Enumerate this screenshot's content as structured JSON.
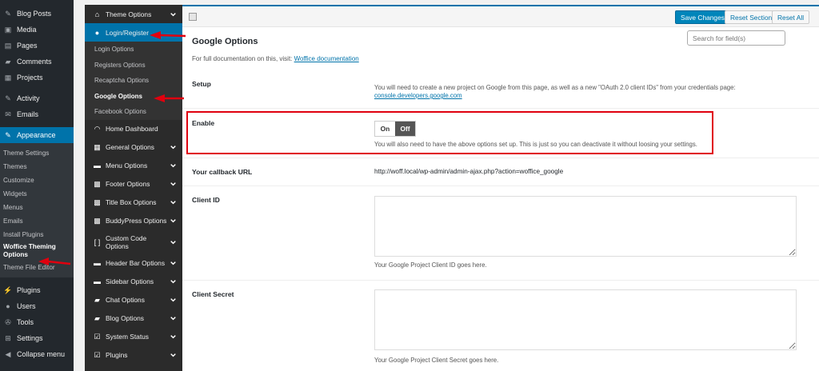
{
  "wp_menu": {
    "items_top": [
      {
        "label": "Blog Posts",
        "icon": "pin-icon",
        "glyph": "✎"
      },
      {
        "label": "Media",
        "icon": "media-icon",
        "glyph": "▣"
      },
      {
        "label": "Pages",
        "icon": "pages-icon",
        "glyph": "▤"
      },
      {
        "label": "Comments",
        "icon": "comment-icon",
        "glyph": "▰"
      },
      {
        "label": "Projects",
        "icon": "projects-icon",
        "glyph": "▦"
      }
    ],
    "items_mid": [
      {
        "label": "Activity",
        "icon": "activity-icon",
        "glyph": "✎"
      },
      {
        "label": "Emails",
        "icon": "email-icon",
        "glyph": "✉"
      }
    ],
    "appearance": {
      "label": "Appearance",
      "glyph": "✎"
    },
    "appearance_sub": [
      "Theme Settings",
      "Themes",
      "Customize",
      "Widgets",
      "Menus",
      "Emails",
      "Install Plugins",
      "Woffice Theming Options",
      "Theme File Editor"
    ],
    "items_bottom": [
      {
        "label": "Plugins",
        "icon": "plugins-icon",
        "glyph": "⚡"
      },
      {
        "label": "Users",
        "icon": "users-icon",
        "glyph": "●"
      },
      {
        "label": "Tools",
        "icon": "tools-icon",
        "glyph": "✇"
      },
      {
        "label": "Settings",
        "icon": "settings-icon",
        "glyph": "⊞"
      },
      {
        "label": "Collapse menu",
        "icon": "collapse-icon",
        "glyph": "◀"
      }
    ]
  },
  "theme_menu": {
    "theme_options": "Theme Options",
    "login_register": "Login/Register",
    "login_sub": [
      "Login Options",
      "Registers Options",
      "Recaptcha Options",
      "Google Options",
      "Facebook Options"
    ],
    "items": [
      {
        "label": "Home Dashboard",
        "icon": "dashboard-icon",
        "glyph": "◠"
      },
      {
        "label": "General Options",
        "icon": "grid-icon",
        "glyph": "▦"
      },
      {
        "label": "Menu Options",
        "icon": "menu-icon",
        "glyph": "▬"
      },
      {
        "label": "Footer Options",
        "icon": "footer-icon",
        "glyph": "▩"
      },
      {
        "label": "Title Box Options",
        "icon": "title-box-icon",
        "glyph": "▩"
      },
      {
        "label": "BuddyPress Options",
        "icon": "buddypress-icon",
        "glyph": "▩"
      },
      {
        "label": "Custom Code Options",
        "icon": "code-icon",
        "glyph": "[ ]"
      },
      {
        "label": "Header Bar Options",
        "icon": "header-icon",
        "glyph": "▬"
      },
      {
        "label": "Sidebar Options",
        "icon": "sidebar-icon",
        "glyph": "▬"
      },
      {
        "label": "Chat Options",
        "icon": "chat-icon",
        "glyph": "▰"
      },
      {
        "label": "Blog Options",
        "icon": "blog-icon",
        "glyph": "▰"
      },
      {
        "label": "System Status",
        "icon": "status-icon",
        "glyph": "☑"
      },
      {
        "label": "Plugins",
        "icon": "plugins-check-icon",
        "glyph": "☑"
      }
    ]
  },
  "header": {
    "save": "Save Changes",
    "reset_section": "Reset Section",
    "reset_all": "Reset All",
    "search_placeholder": "Search for field(s)"
  },
  "section": {
    "title": "Google Options",
    "doc_prefix": "For full documentation on this, visit:",
    "doc_link": "Woffice documentation"
  },
  "setup": {
    "label": "Setup",
    "desc": "You will need to create a new project on Google from this page, as well as a new \"OAuth 2.0 client IDs\" from your credentials page:",
    "link": "console.developers.google.com"
  },
  "enable": {
    "label": "Enable",
    "on": "On",
    "off": "Off",
    "desc": "You will also need to have the above options set up. This is just so you can deactivate it without loosing your settings."
  },
  "callback": {
    "label": "Your callback URL",
    "value": "http://woff.local/wp-admin/admin-ajax.php?action=woffice_google"
  },
  "client_id": {
    "label": "Client ID",
    "desc": "Your Google Project Client ID goes here."
  },
  "client_secret": {
    "label": "Client Secret",
    "desc": "Your Google Project Client Secret goes here."
  },
  "colors": {
    "accent": "#0073aa",
    "annotation": "#e0000f"
  }
}
